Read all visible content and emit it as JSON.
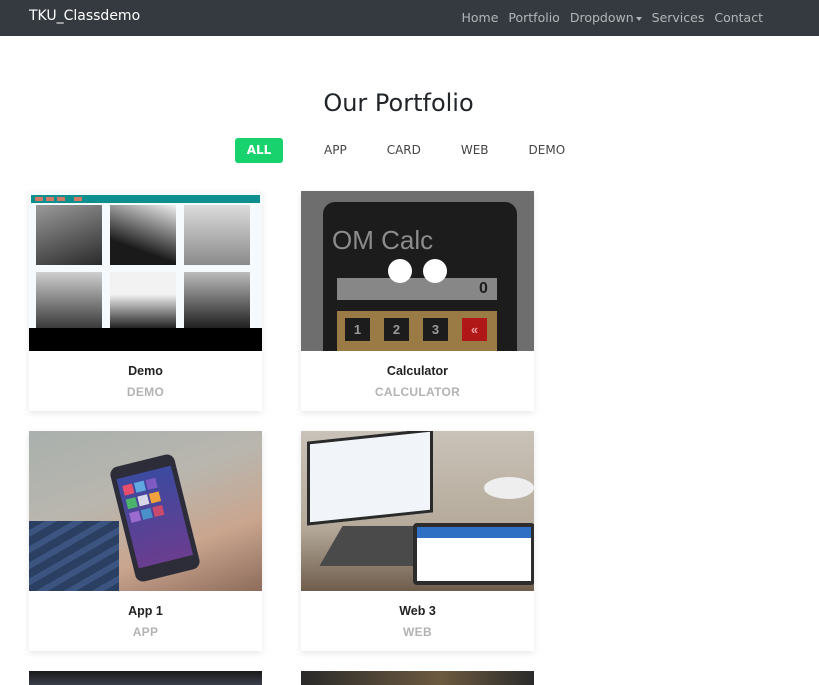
{
  "navbar": {
    "brand": "TKU_Classdemo",
    "links": [
      "Home",
      "Portfolio",
      "Dropdown",
      "Services",
      "Contact"
    ]
  },
  "page": {
    "title": "Our Portfolio"
  },
  "filters": [
    "ALL",
    "APP",
    "CARD",
    "WEB",
    "DEMO"
  ],
  "cards": [
    {
      "title": "Demo",
      "category": "DEMO"
    },
    {
      "title": "Calculator",
      "category": "CALCULATOR",
      "image_text": "OM Calc",
      "display_value": "0",
      "keys": [
        "1",
        "2",
        "3",
        "«"
      ]
    },
    {
      "title": "App 1",
      "category": "APP"
    },
    {
      "title": "Web 3",
      "category": "WEB"
    }
  ],
  "colors": {
    "navbar": "#343a40",
    "accent": "#18d26e",
    "subtitle": "#b3b3b3"
  }
}
